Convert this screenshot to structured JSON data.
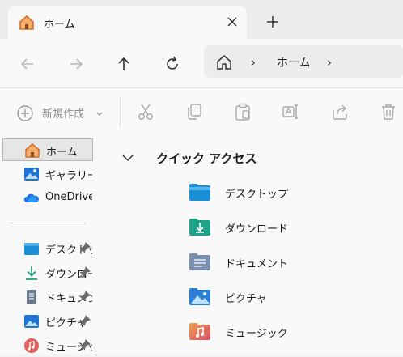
{
  "tab": {
    "title": "ホーム"
  },
  "address": {
    "crumb": "ホーム",
    "separator": "›"
  },
  "commands": {
    "new_label": "新規作成"
  },
  "sidebar": {
    "items": [
      {
        "label": "ホーム",
        "icon": "home-icon",
        "selected": true
      },
      {
        "label": "ギャラリー",
        "icon": "gallery-icon"
      },
      {
        "label": "OneDrive",
        "icon": "onedrive-icon"
      }
    ],
    "pinned": [
      {
        "label": "デスクトップ",
        "icon": "desktop-folder-icon"
      },
      {
        "label": "ダウンロード",
        "icon": "downloads-folder-icon"
      },
      {
        "label": "ドキュメント",
        "icon": "documents-icon"
      },
      {
        "label": "ピクチャ",
        "icon": "pictures-folder-icon"
      },
      {
        "label": "ミュージック",
        "icon": "music-icon"
      }
    ]
  },
  "main": {
    "section_title": "クイック アクセス",
    "folders": [
      {
        "label": "デスクトップ",
        "icon": "desktop-folder-icon"
      },
      {
        "label": "ダウンロード",
        "icon": "downloads-folder-icon"
      },
      {
        "label": "ドキュメント",
        "icon": "documents-folder-icon"
      },
      {
        "label": "ピクチャ",
        "icon": "pictures-folder-icon"
      },
      {
        "label": "ミュージック",
        "icon": "music-folder-icon"
      }
    ]
  },
  "colors": {
    "desktop": "#2a8ad8",
    "downloads": "#1fa28a",
    "documents": "#7b8fb0",
    "pictures": "#2b7fd6",
    "music": "#e87a4a",
    "home": "#e07a3c"
  }
}
